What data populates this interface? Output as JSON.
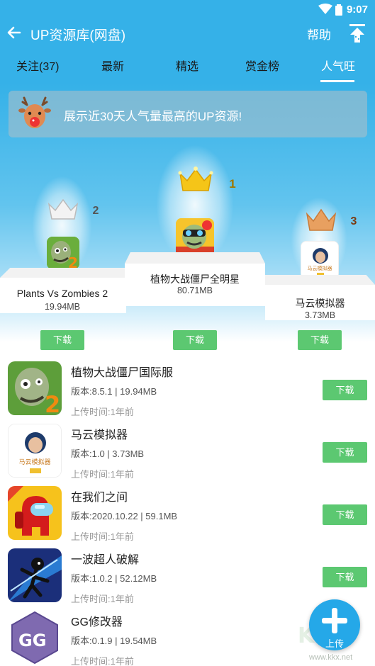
{
  "status": {
    "time": "9:07"
  },
  "appbar": {
    "title": "UP资源库(网盘)",
    "help": "帮助"
  },
  "tabs": [
    {
      "label": "关注(37)"
    },
    {
      "label": "最新"
    },
    {
      "label": "精选"
    },
    {
      "label": "赏金榜"
    },
    {
      "label": "人气旺",
      "active": true
    }
  ],
  "banner": {
    "text": "展示近30天人气量最高的UP资源!"
  },
  "podium": {
    "first": {
      "rank": "1",
      "name": "植物大战僵尸全明星",
      "size": "80.71MB",
      "button": "下载"
    },
    "second": {
      "rank": "2",
      "name": "Plants Vs Zombies 2",
      "size": "19.94MB",
      "button": "下载"
    },
    "third": {
      "rank": "3",
      "name": "马云模拟器",
      "size": "3.73MB",
      "button": "下载"
    }
  },
  "list": [
    {
      "name": "植物大战僵尸国际服",
      "version": "版本:8.5.1 | 19.94MB",
      "time": "上传时间:1年前",
      "button": "下载",
      "icon": "zombie-icon"
    },
    {
      "name": "马云模拟器",
      "version": "版本:1.0 | 3.73MB",
      "time": "上传时间:1年前",
      "button": "下载",
      "icon": "portrait-icon"
    },
    {
      "name": "在我们之间",
      "version": "版本:2020.10.22 | 59.1MB",
      "time": "上传时间:1年前",
      "button": "下载",
      "icon": "crewmate-icon"
    },
    {
      "name": "一波超人破解",
      "version": "版本:1.0.2 | 52.12MB",
      "time": "上传时间:1年前",
      "button": "下载",
      "icon": "stickman-icon"
    },
    {
      "name": "GG修改器",
      "version": "版本:0.1.9 | 19.54MB",
      "time": "上传时间:1年前",
      "icon": "gg-icon"
    }
  ],
  "fab": {
    "label": "上传"
  },
  "watermark": {
    "logo": "KK",
    "url": "www.kkx.net"
  },
  "icon_labels": {
    "mayun": "马云模拟器"
  },
  "colors": {
    "primary": "#35b1e8",
    "download": "#5cc871",
    "fab": "#25a8e8"
  }
}
